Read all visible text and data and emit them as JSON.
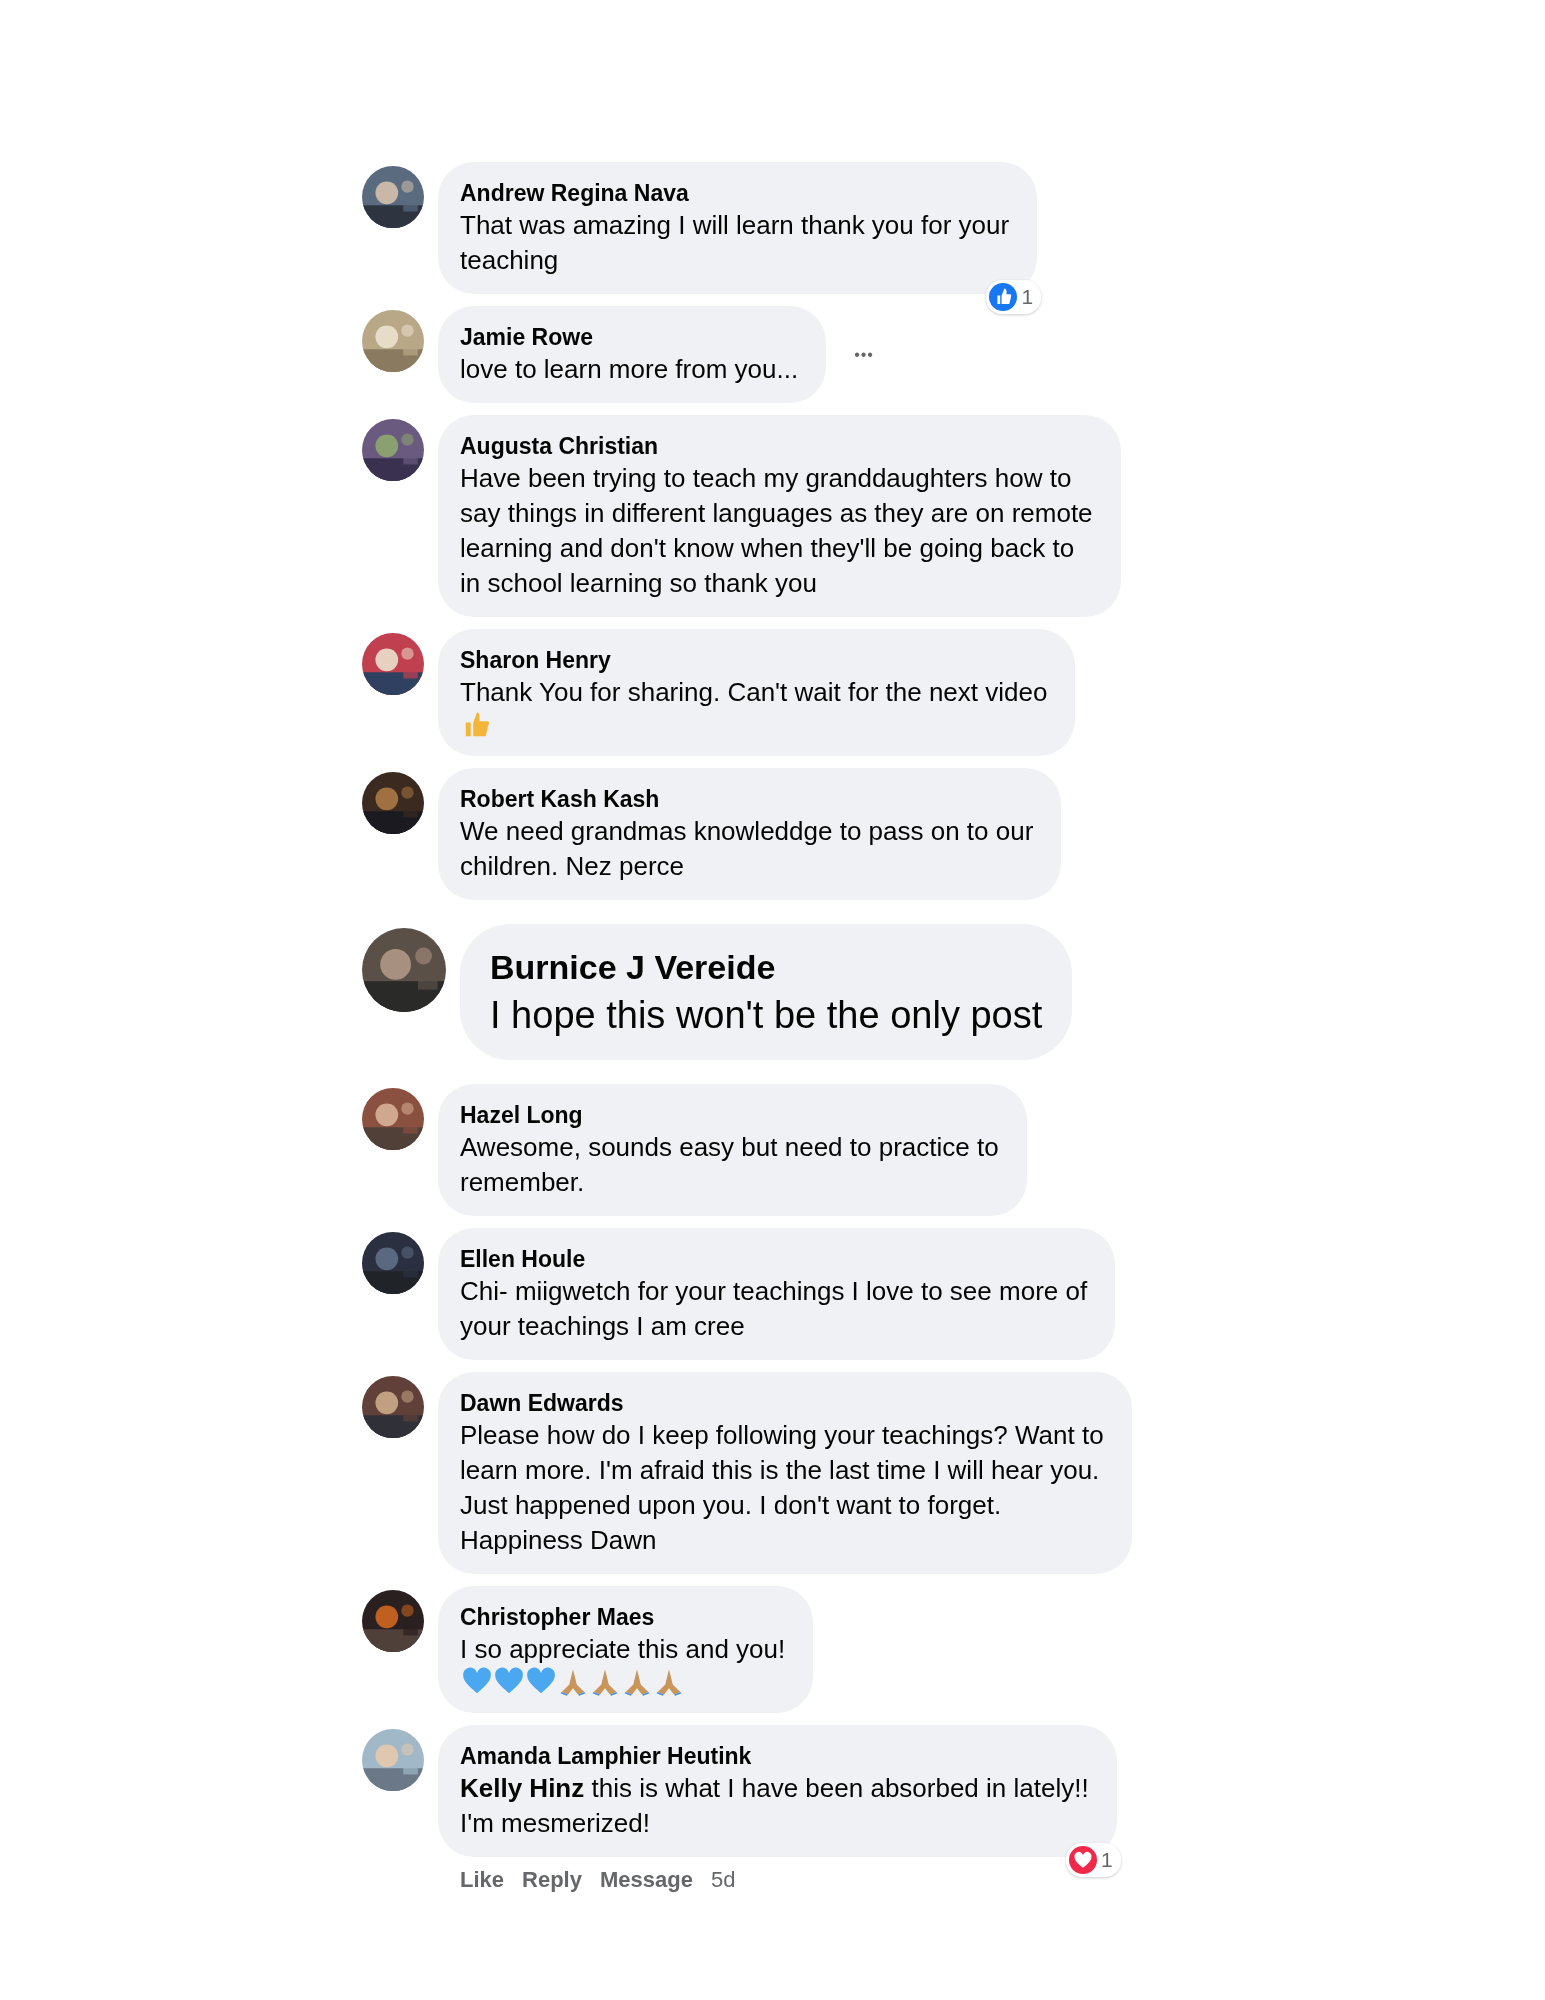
{
  "comments": [
    {
      "name": "Andrew Regina Nava",
      "kind": "normal",
      "lines": [
        "That was amazing I will learn thank you for your",
        "teaching"
      ],
      "reaction": {
        "kind": "like",
        "count": "1"
      }
    },
    {
      "name": "Jamie Rowe",
      "kind": "normal",
      "lines": [
        "love to learn more from you..."
      ],
      "more": "•••"
    },
    {
      "name": "Augusta Christian",
      "kind": "normal",
      "lines": [
        "Have been trying to teach my granddaughters how to",
        "say things in different languages as they are on remote",
        "learning and don't know when they'll be going back to",
        "in school learning so thank you"
      ]
    },
    {
      "name": "Sharon Henry",
      "kind": "normal",
      "lines": [
        "Thank You for sharing. Can't wait for the next video"
      ],
      "emojis": [
        {
          "kind": "thumb"
        }
      ]
    },
    {
      "name": "Robert Kash Kash",
      "kind": "normal",
      "lines": [
        "We need grandmas knowleddge to pass on to our",
        "children. Nez perce"
      ]
    },
    {
      "name": "Burnice J Vereide",
      "kind": "large",
      "lines": [
        "I hope this won't be the only post"
      ]
    },
    {
      "name": "Hazel Long",
      "kind": "normal",
      "lines": [
        "Awesome, sounds easy but need to practice to",
        "remember."
      ]
    },
    {
      "name": "Ellen Houle",
      "kind": "normal",
      "lines": [
        "Chi- miigwetch for your teachings I love to see more of",
        "your teachings I am cree"
      ]
    },
    {
      "name": "Dawn Edwards",
      "kind": "normal",
      "lines": [
        "Please how do I keep following your teachings? Want to",
        "learn more. I'm afraid this is the last time I will hear you.",
        "Just happened upon you. I don't want to forget.",
        "Happiness Dawn"
      ]
    },
    {
      "name": "Christopher Maes",
      "kind": "normal",
      "lines": [
        "I so appreciate this and you!"
      ],
      "emojis": [
        {
          "kind": "heart"
        },
        {
          "kind": "heart"
        },
        {
          "kind": "heart"
        },
        {
          "kind": "pray"
        },
        {
          "kind": "pray"
        },
        {
          "kind": "pray"
        },
        {
          "kind": "pray"
        }
      ]
    },
    {
      "name": "Amanda Lamphier Heutink",
      "kind": "normal",
      "lines": [
        "**Kelly Hinz** this is what I have been absorbed in lately!!",
        "I'm mesmerized!"
      ],
      "reaction": {
        "kind": "love",
        "count": "1"
      },
      "actions": [
        "Like",
        "Reply",
        "Message"
      ],
      "time": "5d"
    }
  ]
}
